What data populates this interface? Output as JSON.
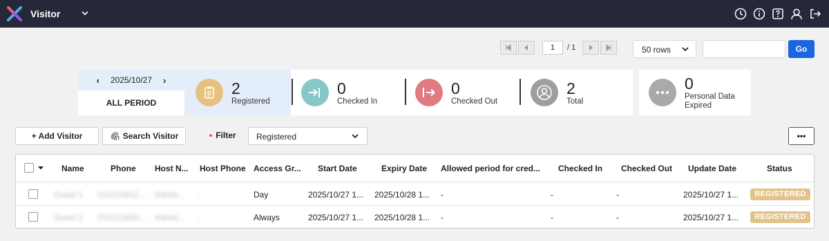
{
  "header": {
    "app_title": "Visitor",
    "icons": [
      "clock-icon",
      "info-icon",
      "help-icon",
      "user-icon",
      "logout-icon"
    ]
  },
  "pager": {
    "current_page": "1",
    "total_pages": "/ 1",
    "rows_option": "50 rows",
    "search_value": "",
    "go_label": "Go"
  },
  "summary": {
    "date": "2025/10/27",
    "all_period_label": "ALL PERIOD",
    "stats": [
      {
        "value": "2",
        "label": "Registered",
        "color": "#e6c07e",
        "icon": "clipboard-icon"
      },
      {
        "value": "0",
        "label": "Checked In",
        "color": "#86c7c8",
        "icon": "check-in-icon"
      },
      {
        "value": "0",
        "label": "Checked Out",
        "color": "#e07b80",
        "icon": "check-out-icon"
      },
      {
        "value": "2",
        "label": "Total",
        "color": "#9e9e9e",
        "icon": "person-icon"
      },
      {
        "value": "0",
        "label": "Personal Data Expired",
        "color": "#a9a9a9",
        "icon": "more-icon"
      }
    ]
  },
  "toolbar": {
    "add_visitor_label": "+ Add Visitor",
    "search_visitor_label": "Search Visitor",
    "filter_label": "Filter",
    "filter_value": "Registered",
    "more_label": "•••"
  },
  "table": {
    "columns": [
      "Name",
      "Phone",
      "Host N...",
      "Host Phone",
      "Access Gr...",
      "Start Date",
      "Expiry Date",
      "Allowed period for cred...",
      "Checked In",
      "Checked Out",
      "Update Date",
      "Status"
    ],
    "rows": [
      {
        "name": "Guest 1",
        "phone": "010123412...",
        "host_name": "Admin...",
        "host_phone": "-",
        "access_group": "Day",
        "start_date": "2025/10/27 1...",
        "expiry_date": "2025/10/28 1...",
        "allowed_period": "-",
        "checked_in": "-",
        "checked_out": "-",
        "update_date": "2025/10/27 1...",
        "status": "REGISTERED"
      },
      {
        "name": "Guest 2",
        "phone": "010123430...",
        "host_name": "Admin...",
        "host_phone": "-",
        "access_group": "Always",
        "start_date": "2025/10/27 1...",
        "expiry_date": "2025/10/28 1...",
        "allowed_period": "-",
        "checked_in": "-",
        "checked_out": "-",
        "update_date": "2025/10/27 1...",
        "status": "REGISTERED"
      }
    ]
  },
  "colors": {
    "topbar": "#242838",
    "accent": "#1a66e0",
    "status_badge": "#e1c38b",
    "highlight": "#e4eefb"
  }
}
